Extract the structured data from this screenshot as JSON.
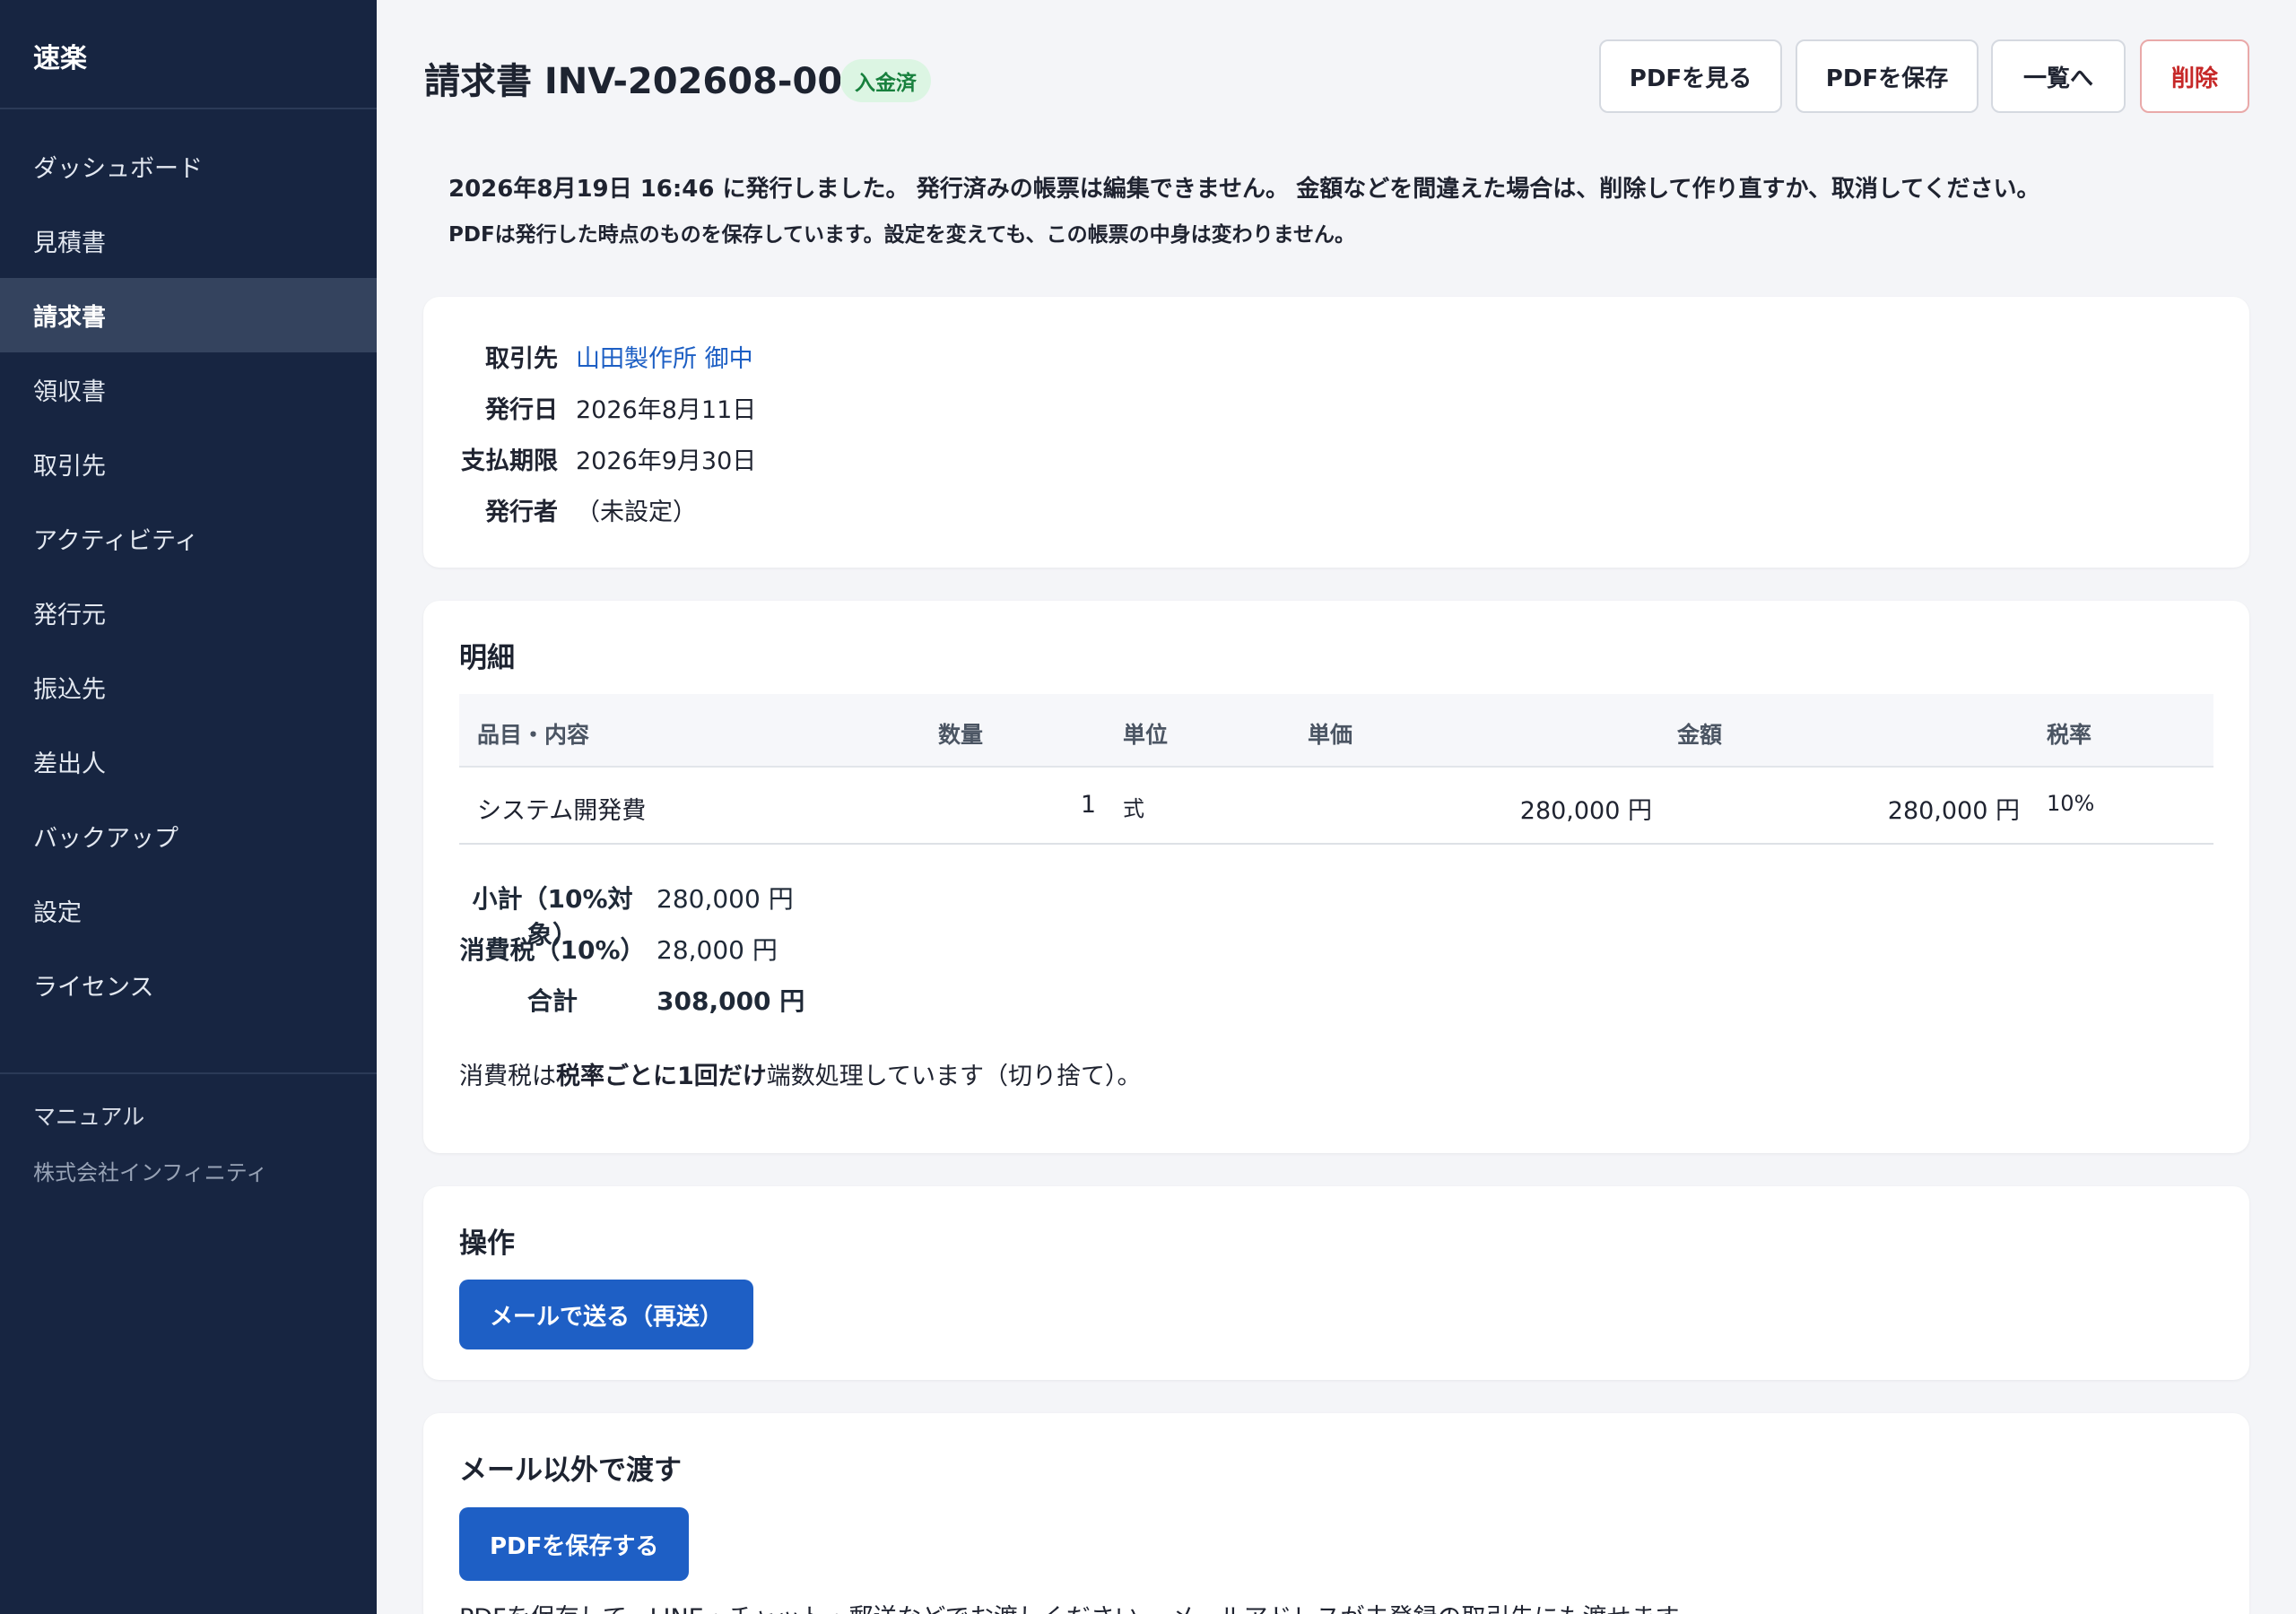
{
  "app": {
    "brand": "速楽"
  },
  "sidebar": {
    "items": [
      {
        "label": "ダッシュボード"
      },
      {
        "label": "見積書"
      },
      {
        "label": "請求書",
        "active": true
      },
      {
        "label": "領収書"
      },
      {
        "label": "取引先"
      },
      {
        "label": "アクティビティ"
      },
      {
        "label": "発行元"
      },
      {
        "label": "振込先"
      },
      {
        "label": "差出人"
      },
      {
        "label": "バックアップ"
      },
      {
        "label": "設定"
      },
      {
        "label": "ライセンス"
      }
    ],
    "manual_link": "マニュアル",
    "company": "株式会社インフィニティ"
  },
  "header": {
    "title": "請求書 INV-202608-001",
    "status_badge": "入金済",
    "buttons": {
      "view_pdf": "PDFを見る",
      "save_pdf": "PDFを保存",
      "back_to_list": "一覧へ",
      "delete": "削除"
    }
  },
  "notice": {
    "issued_text": "2026年8月19日 16:46 に発行しました。",
    "not_editable": "発行済みの帳票は編集できません。",
    "mistake_prefix": "金額などを間違えた場合は、",
    "mistake_bold": "削除して作り直す",
    "mistake_suffix": "か、取消してください。",
    "pdf_snapshot": "PDFは発行した時点のものを保存しています。設定を変えても、この帳票の中身は変わりません。"
  },
  "meta": {
    "client_label": "取引先",
    "client_value": "山田製作所 御中",
    "issue_date_label": "発行日",
    "issue_date_value": "2026年8月11日",
    "due_date_label": "支払期限",
    "due_date_value": "2026年9月30日",
    "issuer_label": "発行者",
    "issuer_value": "（未設定）"
  },
  "details": {
    "title": "明細",
    "columns": [
      "品目・内容",
      "数量",
      "単位",
      "単価",
      "金額",
      "税率"
    ],
    "rows": [
      {
        "item": "システム開発費",
        "qty": "1",
        "unit": "式",
        "unit_price": "280,000 円",
        "amount": "280,000 円",
        "tax_rate": "10%"
      }
    ],
    "subtotal_label": "小計（10%対象）",
    "subtotal_value": "280,000 円",
    "tax_label": "消費税（10%）",
    "tax_value": "28,000 円",
    "total_label": "合計",
    "total_value": "308,000 円",
    "rounding_prefix": "消費税は",
    "rounding_bold": "税率ごとに1回だけ",
    "rounding_suffix": "端数処理しています（切り捨て）。"
  },
  "operations": {
    "title": "操作",
    "resend_button": "メールで送る（再送）"
  },
  "non_email": {
    "title": "メール以外で渡す",
    "save_pdf_button": "PDFを保存する",
    "note": "PDFを保存して、LINE・チャット・郵送などでお渡しください。 メールアドレスが未登録の取引先にも渡せます。"
  },
  "colors": {
    "sidebar_bg": "#172541",
    "sidebar_active_bg": "#34435e",
    "primary": "#1e5fc5",
    "link": "#1d5fc4",
    "danger": "#c62828",
    "badge_bg": "#dcf5e3",
    "badge_text": "#17803d"
  }
}
